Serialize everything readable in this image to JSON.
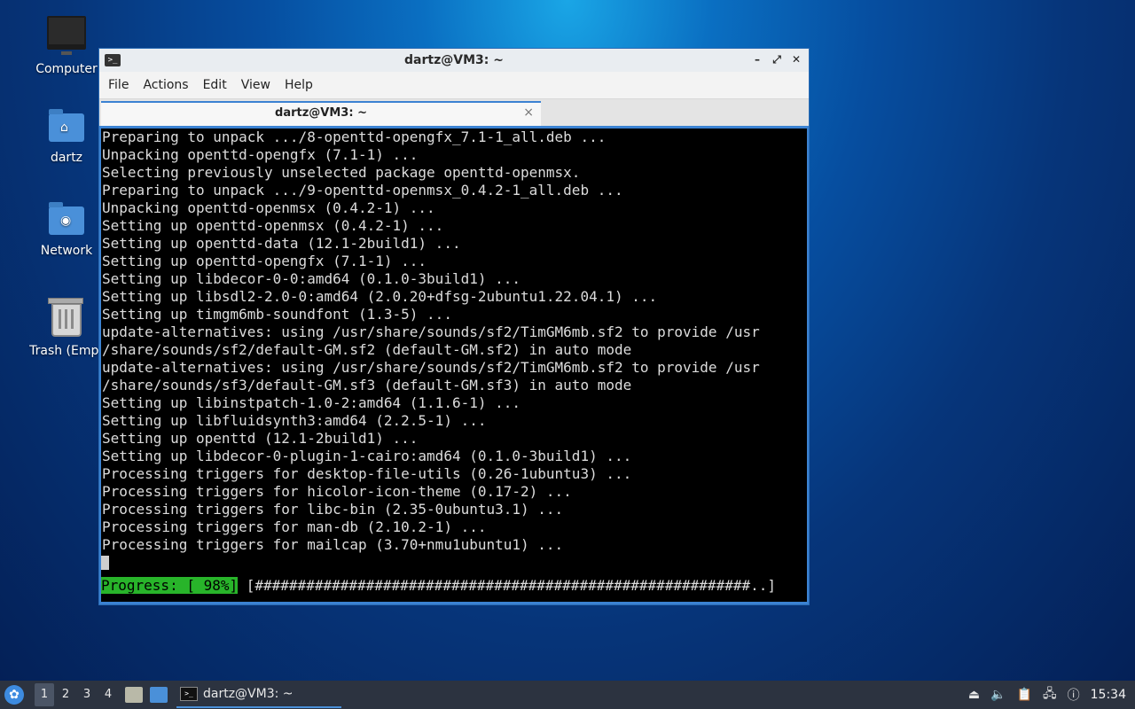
{
  "desktop": {
    "icons": [
      {
        "label": "Computer"
      },
      {
        "label": "dartz"
      },
      {
        "label": "Network"
      },
      {
        "label": "Trash (Empt"
      }
    ]
  },
  "window": {
    "title": "dartz@VM3: ~",
    "icon_glyph": ">_",
    "buttons": {
      "minimize": "–",
      "maximize": "⤢",
      "close": "✕"
    },
    "menu": [
      "File",
      "Actions",
      "Edit",
      "View",
      "Help"
    ],
    "tab": {
      "label": "dartz@VM3: ~",
      "close": "×"
    }
  },
  "terminal": {
    "lines": [
      "Preparing to unpack .../8-openttd-opengfx_7.1-1_all.deb ...",
      "Unpacking openttd-opengfx (7.1-1) ...",
      "Selecting previously unselected package openttd-openmsx.",
      "Preparing to unpack .../9-openttd-openmsx_0.4.2-1_all.deb ...",
      "Unpacking openttd-openmsx (0.4.2-1) ...",
      "Setting up openttd-openmsx (0.4.2-1) ...",
      "Setting up openttd-data (12.1-2build1) ...",
      "Setting up openttd-opengfx (7.1-1) ...",
      "Setting up libdecor-0-0:amd64 (0.1.0-3build1) ...",
      "Setting up libsdl2-2.0-0:amd64 (2.0.20+dfsg-2ubuntu1.22.04.1) ...",
      "Setting up timgm6mb-soundfont (1.3-5) ...",
      "update-alternatives: using /usr/share/sounds/sf2/TimGM6mb.sf2 to provide /usr",
      "/share/sounds/sf2/default-GM.sf2 (default-GM.sf2) in auto mode",
      "update-alternatives: using /usr/share/sounds/sf2/TimGM6mb.sf2 to provide /usr",
      "/share/sounds/sf3/default-GM.sf3 (default-GM.sf3) in auto mode",
      "Setting up libinstpatch-1.0-2:amd64 (1.1.6-1) ...",
      "Setting up libfluidsynth3:amd64 (2.2.5-1) ...",
      "Setting up openttd (12.1-2build1) ...",
      "Setting up libdecor-0-plugin-1-cairo:amd64 (0.1.0-3build1) ...",
      "Processing triggers for desktop-file-utils (0.26-1ubuntu3) ...",
      "Processing triggers for hicolor-icon-theme (0.17-2) ...",
      "Processing triggers for libc-bin (2.35-0ubuntu3.1) ...",
      "Processing triggers for man-db (2.10.2-1) ...",
      "Processing triggers for mailcap (3.70+nmu1ubuntu1) ..."
    ],
    "progress_label": "Progress: [ 98%]",
    "progress_bar": " [##########################################################..]",
    "progress_percent": 98
  },
  "taskbar": {
    "workspaces": [
      "1",
      "2",
      "3",
      "4"
    ],
    "active_workspace": "1",
    "task_label": "dartz@VM3: ~",
    "clock": "15:34"
  },
  "colors": {
    "accent": "#3b82d2",
    "progress_green": "#28b42a",
    "taskbar_bg": "#2c3340"
  }
}
